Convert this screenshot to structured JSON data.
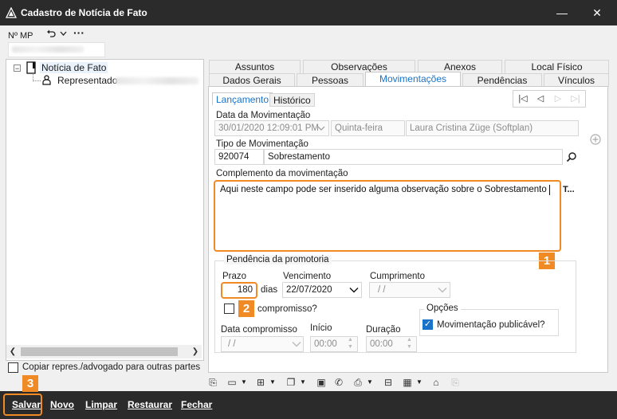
{
  "window": {
    "title": "Cadastro de Notícia de Fato",
    "minimize": "—",
    "close": "✕"
  },
  "header": {
    "mp_label": "Nº MP"
  },
  "tree": {
    "root_label": "Notícia de Fato",
    "child_label": "Representado",
    "copy_label": "Copiar repres./advogado para outras partes"
  },
  "tabs_row1": [
    "Assuntos",
    "Observações",
    "Anexos",
    "Local Físico"
  ],
  "tabs_row2": [
    "Dados Gerais",
    "Pessoas",
    "Movimentações",
    "Pendências",
    "Vínculos"
  ],
  "subtabs": [
    "Lançamento",
    "Histórico"
  ],
  "form": {
    "data_mov_label": "Data da Movimentação",
    "data_mov_value": "30/01/2020 12:09:01 PM",
    "weekday": "Quinta-feira",
    "user": "Laura Cristina Züge (Softplan)",
    "tipo_label": "Tipo de Movimentação",
    "tipo_code": "920074",
    "tipo_desc": "Sobrestamento",
    "complemento_label": "Complemento da movimentação",
    "complemento_value": "Aqui neste campo pode ser inserido alguma observação sobre o Sobrestamento",
    "complemento_overflow": "T...",
    "pendencia_title": "Pendência da promotoria",
    "prazo_label": "Prazo",
    "prazo_value": "180",
    "dias_label": "dias",
    "vencimento_label": "Vencimento",
    "vencimento_value": "22/07/2020",
    "cumprimento_label": "Cumprimento",
    "cumprimento_value": "/ /",
    "compromisso_label": "compromisso?",
    "data_compromisso_label": "Data compromisso",
    "data_compromisso_value": "/ /",
    "inicio_label": "Início",
    "inicio_value": "00:00",
    "duracao_label": "Duração",
    "duracao_value": "00:00",
    "opcoes_title": "Opções",
    "publicavel_label": "Movimentação publicável?"
  },
  "badges": [
    "1",
    "2",
    "3"
  ],
  "bottom": {
    "salvar": "Salvar",
    "novo": "Novo",
    "limpar": "Limpar",
    "restaurar": "Restaurar",
    "fechar": "Fechar"
  }
}
